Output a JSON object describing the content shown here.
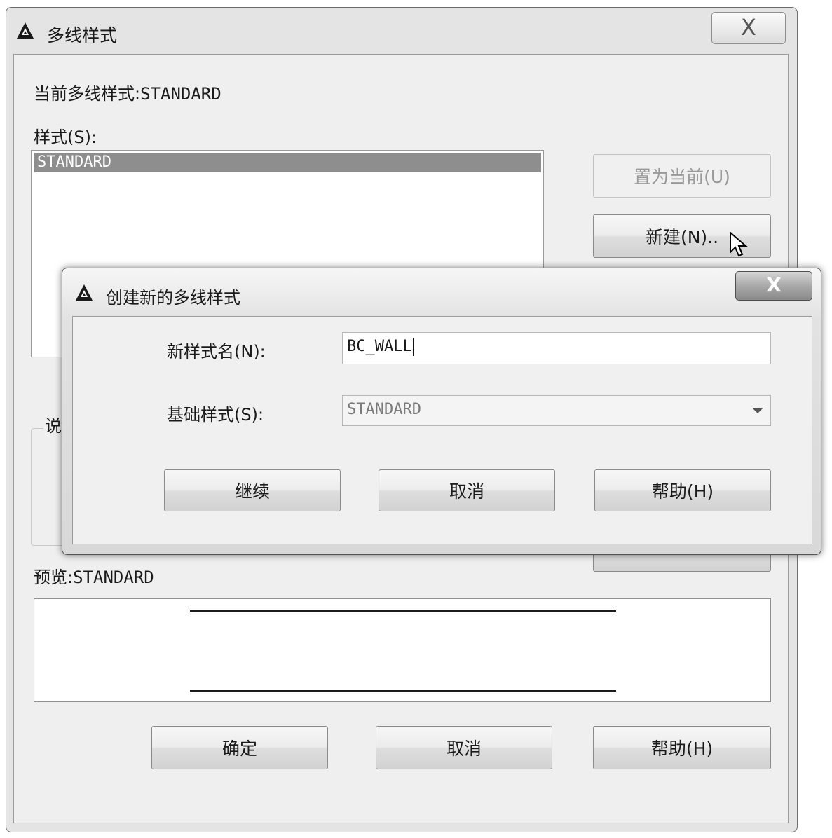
{
  "main_window": {
    "title": "多线样式",
    "close_glyph": "X",
    "current_style_label": "当前多线样式:",
    "current_style_value": "STANDARD",
    "styles_label": "样式(S):",
    "styles_list": [
      "STANDARD"
    ],
    "set_current_button": "置为当前(U)",
    "new_button": "新建(N)..",
    "description_label": "说",
    "preview_label": "预览:",
    "preview_value": "STANDARD",
    "ok_button": "确定",
    "cancel_button": "取消",
    "help_button": "帮助(H)"
  },
  "dialog": {
    "title": "创建新的多线样式",
    "close_glyph": "X",
    "new_style_name_label": "新样式名(N):",
    "new_style_name_value": "BC_WALL",
    "base_style_label": "基础样式(S):",
    "base_style_value": "STANDARD",
    "continue_button": "继续",
    "cancel_button": "取消",
    "help_button": "帮助(H)"
  },
  "icons": {
    "app_icon": "autocad-triangle-icon",
    "cursor": "mouse-pointer-icon",
    "dropdown": "chevron-down-icon"
  },
  "colors": {
    "selection_bg": "#8e8e8e",
    "window_bg": "#efefef"
  }
}
